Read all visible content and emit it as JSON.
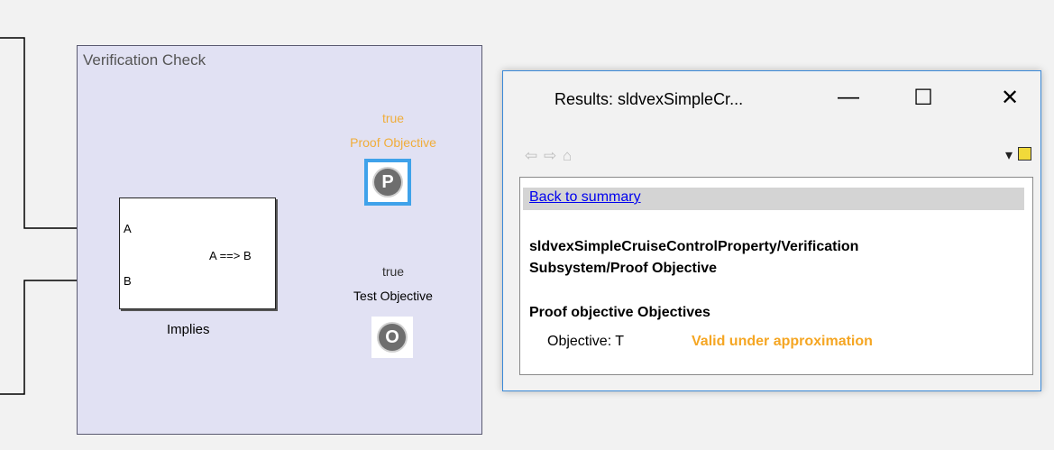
{
  "colors": {
    "canvas_bg": "#f2f2f2",
    "subsystem_bg": "#e1e1f3",
    "proof_label": "#f0ad3a",
    "highlight": "#3fa2ea",
    "status_valid": "#f5a623",
    "link": "#0000ee"
  },
  "model": {
    "subsystem_title": "Verification Check",
    "implies_block": {
      "port_a": "A",
      "port_b": "B",
      "output": "A ==> B",
      "caption": "Implies"
    },
    "proof_objective": {
      "value": "true",
      "name": "Proof Objective",
      "symbol": "P"
    },
    "test_objective": {
      "value": "true",
      "name": "Test Objective",
      "symbol": "O"
    }
  },
  "results_window": {
    "title": "Results: sldvexSimpleCr...",
    "buttons": {
      "minimize": "—",
      "maximize": "☐",
      "close": "✕"
    },
    "nav": {
      "back_icon": "⇦",
      "forward_icon": "⇨",
      "home_icon": "⌂",
      "dropdown_icon": "▾"
    },
    "back_link": "Back to summary",
    "path_line1": "sldvexSimpleCruiseControlProperty/Verification",
    "path_line2": "Subsystem/Proof Objective",
    "section_heading": "Proof objective Objectives",
    "objective_label": "Objective: T",
    "objective_status": "Valid under approximation"
  }
}
